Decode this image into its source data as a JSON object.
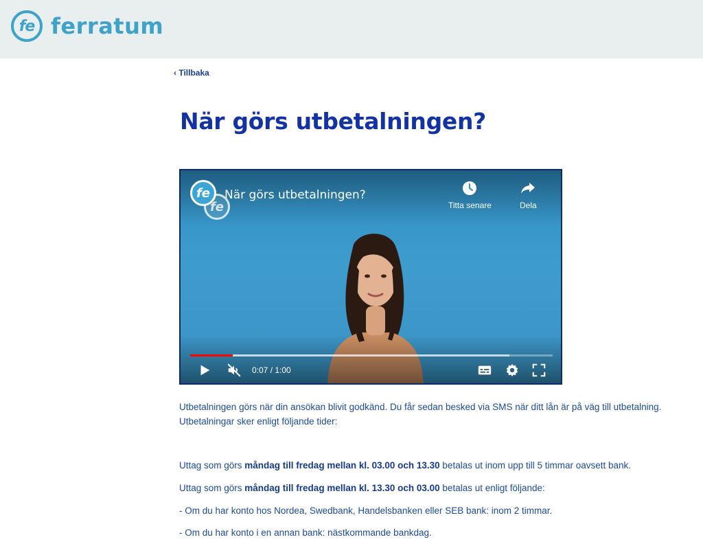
{
  "header": {
    "logo_mark": "fe",
    "logo_text": "ferratum"
  },
  "nav": {
    "back_label": "‹ Tillbaka"
  },
  "page": {
    "title": "När görs utbetalningen?"
  },
  "video": {
    "channel_logo": "fe",
    "title": "När görs utbetalningen?",
    "watch_later_label": "Titta senare",
    "share_label": "Dela",
    "time": "0:07 / 1:00",
    "progress_played_fraction": 0.117,
    "progress_buffered_fraction": 0.88,
    "muted": true,
    "icons": {
      "watch_later": "clock-icon",
      "share": "share-arrow-icon",
      "play": "play-icon",
      "mute": "muted-speaker-icon",
      "captions": "subtitles-icon",
      "settings": "gear-icon",
      "fullscreen": "fullscreen-icon"
    },
    "colors": {
      "background": "#3a96c8",
      "progress": "#ff0000"
    }
  },
  "content": {
    "intro": "Utbetalningen görs när din ansökan blivit godkänd. Du får sedan besked via SMS när ditt lån är på väg till utbetalning. Utbetalningar sker enligt följande tider:",
    "line1_pre": "Uttag som görs ",
    "line1_bold": "måndag till fredag mellan kl. 03.00 och 13.30",
    "line1_post": " betalas ut inom upp till 5 timmar oavsett bank.",
    "line2_pre": "Uttag som görs ",
    "line2_bold": "måndag till fredag mellan kl. 13.30 och 03.00",
    "line2_post": " betalas ut enligt följande:",
    "bullet1": "- Om du har konto hos Nordea, Swedbank, Handelsbanken eller SEB bank:  inom 2 timmar.",
    "bullet2": "- Om du har konto i en annan bank: nästkommande bankdag."
  },
  "colors": {
    "header_bg": "#e9eeee",
    "brand": "#3fa3c9",
    "title": "#1433a3",
    "text": "#1c4a9c"
  }
}
